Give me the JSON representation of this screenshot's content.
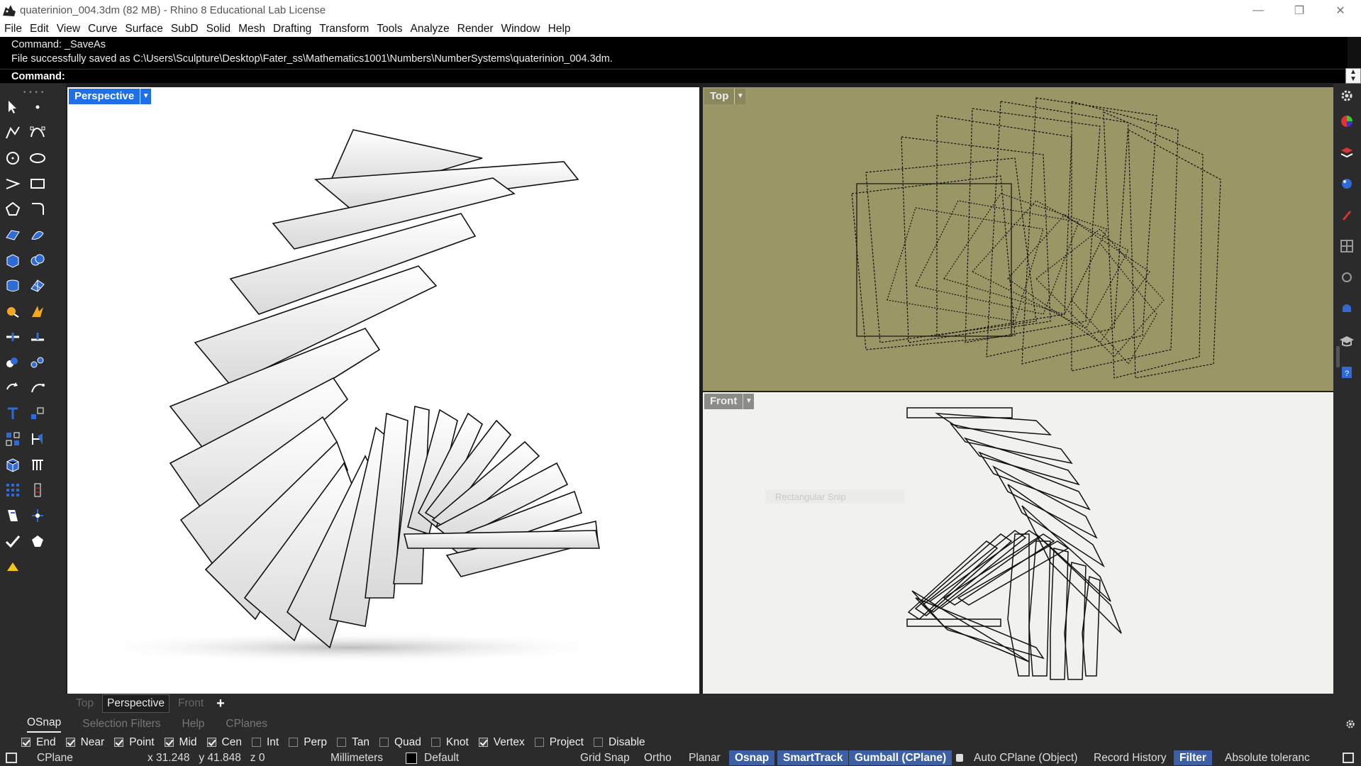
{
  "window": {
    "title": "quaterinion_004.3dm (82 MB) - Rhino 8 Educational Lab License",
    "minimize": "—",
    "maximize": "❐",
    "close": "✕"
  },
  "menu": [
    "File",
    "Edit",
    "View",
    "Curve",
    "Surface",
    "SubD",
    "Solid",
    "Mesh",
    "Drafting",
    "Transform",
    "Tools",
    "Analyze",
    "Render",
    "Window",
    "Help"
  ],
  "command": {
    "history": [
      "Command: _SaveAs",
      "File successfully saved as C:\\Users\\Sculpture\\Desktop\\Fater_ss\\Mathematics1001\\Numbers\\NumberSystems\\quaterinion_004.3dm."
    ],
    "prompt": "Command:"
  },
  "viewports": {
    "perspective": {
      "label": "Perspective",
      "accent": "#1f6fe8"
    },
    "top": {
      "label": "Top",
      "bg": "#9a9666"
    },
    "front": {
      "label": "Front",
      "bg": "#f1f1ed",
      "ghost_text": "Rectangular Snip"
    }
  },
  "view_tabs": {
    "items": [
      "Top",
      "Perspective",
      "Front"
    ],
    "active": "Perspective",
    "add": "+"
  },
  "panel_tabs": {
    "items": [
      "OSnap",
      "Selection Filters",
      "Help",
      "CPlanes"
    ],
    "active": "OSnap"
  },
  "osnaps": [
    {
      "label": "End",
      "on": true
    },
    {
      "label": "Near",
      "on": true
    },
    {
      "label": "Point",
      "on": true
    },
    {
      "label": "Mid",
      "on": true
    },
    {
      "label": "Cen",
      "on": true
    },
    {
      "label": "Int",
      "on": false
    },
    {
      "label": "Perp",
      "on": false
    },
    {
      "label": "Tan",
      "on": false
    },
    {
      "label": "Quad",
      "on": false
    },
    {
      "label": "Knot",
      "on": false
    },
    {
      "label": "Vertex",
      "on": true
    },
    {
      "label": "Project",
      "on": false
    },
    {
      "label": "Disable",
      "on": false
    }
  ],
  "status": {
    "cplane": "CPlane",
    "coords": "x 31.248   y 41.848   z 0",
    "units": "Millimeters",
    "layer": "Default",
    "grid_snap": "Grid Snap",
    "ortho": "Ortho",
    "planar": "Planar",
    "osnap": "Osnap",
    "smarttrack": "SmartTrack",
    "gumball": "Gumball (CPlane)",
    "auto_cplane": "Auto CPlane (Object)",
    "record_history": "Record History",
    "filter": "Filter",
    "tolerance": "Absolute toleranc"
  },
  "colors": {
    "active_pill": "#3c5fa6",
    "panel": "#2b2b2b",
    "perspective_tab": "#1f6fe8"
  }
}
